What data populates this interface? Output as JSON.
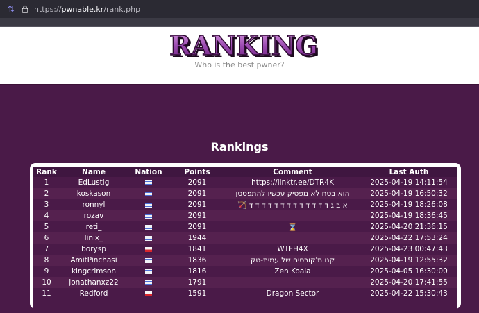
{
  "browser": {
    "url_prefix": "https://",
    "url_host": "pwnable.kr",
    "url_path": "/rank.php"
  },
  "header": {
    "logo_text": "RANKING",
    "tagline": "Who is the best pwner?"
  },
  "main": {
    "title": "Rankings",
    "columns": [
      "Rank",
      "Name",
      "Nation",
      "Points",
      "Comment",
      "Last Auth"
    ],
    "rows": [
      {
        "rank": "1",
        "name": "EdLustig",
        "nation": "il",
        "points": "2091",
        "comment": "https://linktr.ee/DTR4K",
        "last_auth": "2025-04-19 14:11:54"
      },
      {
        "rank": "2",
        "name": "koskason",
        "nation": "il",
        "points": "2091",
        "comment": "הוא בטח לא מפסיק עכשיו להתפסטן",
        "last_auth": "2025-04-19 16:50:32"
      },
      {
        "rank": "3",
        "name": "ronnyl",
        "nation": "il",
        "points": "2091",
        "comment": "א ב ג ד ד ד ד ד ד ד ד ד ד ד ד ד 🏹",
        "last_auth": "2025-04-19 18:26:08"
      },
      {
        "rank": "4",
        "name": "rozav",
        "nation": "il",
        "points": "2091",
        "comment": "",
        "last_auth": "2025-04-19 18:36:45"
      },
      {
        "rank": "5",
        "name": "reti_",
        "nation": "il",
        "points": "2091",
        "comment": "⌛",
        "last_auth": "2025-04-20 21:36:15"
      },
      {
        "rank": "6",
        "name": "linix_",
        "nation": "il",
        "points": "1944",
        "comment": "",
        "last_auth": "2025-04-22 17:53:24"
      },
      {
        "rank": "7",
        "name": "borysp",
        "nation": "pl",
        "points": "1841",
        "comment": "WTFH4X",
        "last_auth": "2025-04-23 00:47:43"
      },
      {
        "rank": "8",
        "name": "AmitPinchasi",
        "nation": "il",
        "points": "1836",
        "comment": "קנו ת'קורסים של עמית-טק",
        "last_auth": "2025-04-19 12:55:32"
      },
      {
        "rank": "9",
        "name": "kingcrimson",
        "nation": "il",
        "points": "1816",
        "comment": "Zen Koala",
        "last_auth": "2025-04-05 16:30:00"
      },
      {
        "rank": "10",
        "name": "jonathanxz22",
        "nation": "il",
        "points": "1791",
        "comment": "",
        "last_auth": "2025-04-20 17:41:55"
      },
      {
        "rank": "11",
        "name": "Redford",
        "nation": "pl",
        "points": "1591",
        "comment": "Dragon Sector",
        "last_auth": "2025-04-22 15:30:43"
      }
    ]
  }
}
